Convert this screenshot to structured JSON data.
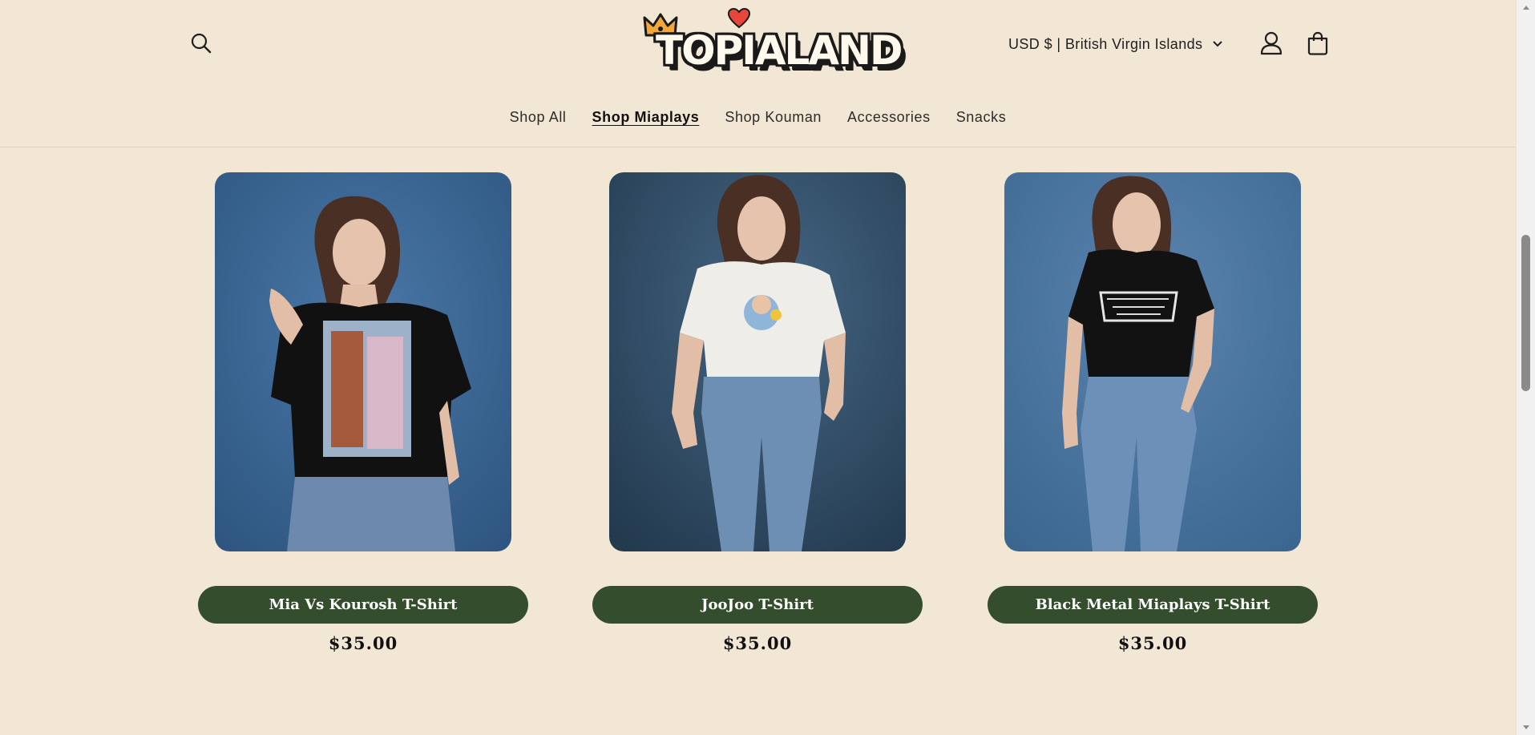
{
  "brand": {
    "logo_text": "TOPIALAND"
  },
  "header": {
    "currency_label": "USD $ | British Virgin Islands",
    "icons": {
      "search": "search-icon",
      "account": "user-icon",
      "cart": "shopping-bag-icon",
      "currency_caret": "chevron-down-icon"
    }
  },
  "nav": {
    "items": [
      {
        "label": "Shop All",
        "active": false
      },
      {
        "label": "Shop Miaplays",
        "active": true
      },
      {
        "label": "Shop Kouman",
        "active": false
      },
      {
        "label": "Accessories",
        "active": false
      },
      {
        "label": "Snacks",
        "active": false
      }
    ]
  },
  "products": [
    {
      "title": "Mia Vs Kourosh T-Shirt",
      "price": "$35.00",
      "shirt": "black with painted artwork print"
    },
    {
      "title": "JooJoo T-Shirt",
      "price": "$35.00",
      "shirt": "white with cartoon print"
    },
    {
      "title": "Black Metal Miaplays T-Shirt",
      "price": "$35.00",
      "shirt": "black with metal logo print"
    }
  ],
  "colors": {
    "page_background": "#f2e6d4",
    "button_green": "#344d2c",
    "photo_blue": "#3f6a99",
    "photo_dark_blue": "#2f4a62"
  }
}
